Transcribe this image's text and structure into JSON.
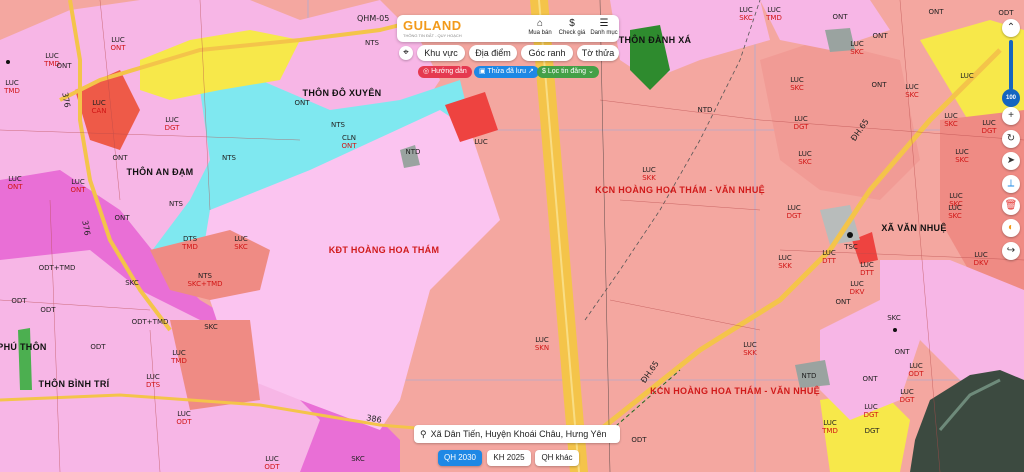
{
  "app": {
    "logo": "GULAND",
    "logo_sub": "THÔNG TIN ĐẤT - QUY HOẠCH"
  },
  "toolbar": {
    "buttons": [
      {
        "label": "Mua bán",
        "icon": "house-icon"
      },
      {
        "label": "Check giá",
        "icon": "dollar-icon"
      },
      {
        "label": "Danh mục",
        "icon": "menu-icon"
      }
    ],
    "chips": [
      "Khu vực",
      "Địa điểm",
      "Góc ranh",
      "Tờ thửa"
    ],
    "pills": [
      {
        "label": "Hướng dẫn",
        "color": "#e53950",
        "icon": "help-icon"
      },
      {
        "label": "Thửa đã lưu",
        "color": "#1e88e5",
        "icon": "bookmark-icon"
      },
      {
        "label": "Lọc tin đăng",
        "color": "#43a047",
        "icon": "dollar-icon"
      }
    ]
  },
  "map": {
    "zoom_level": "100",
    "address": "Xã Dân Tiến, Huyện Khoái Châu, Hưng Yên",
    "place_names": [
      {
        "text": "THÔN ĐÔ XUYÊN"
      },
      {
        "text": "THÔN AN ĐẠM"
      },
      {
        "text": "THÔN ĐÀNH XÁ"
      },
      {
        "text": "XÃ VĂN NHUỆ"
      },
      {
        "text": "THÔN BÌNH TRÍ"
      },
      {
        "text": "PHÚ THÔN"
      }
    ],
    "zones": [
      {
        "text": "KĐT HOÀNG HOA THÁM"
      },
      {
        "text": "KCN HOÀNG HOA THÁM - VĂN NHUỆ"
      },
      {
        "text": "KCN HOÀNG HOA THÁM - VĂN NHUỆ"
      }
    ],
    "roads": [
      "QHM-05",
      "376",
      "376",
      "ĐH.65",
      "ĐH.65",
      "386"
    ],
    "parcels": [
      [
        "LUC",
        "CAN"
      ],
      [
        "LUC",
        "TMD"
      ],
      [
        "LUC",
        "TMD"
      ],
      [
        "ONT",
        ""
      ],
      [
        "ONT",
        ""
      ],
      [
        "ONT",
        ""
      ],
      [
        "ONT",
        ""
      ],
      [
        "NTS",
        ""
      ],
      [
        "NTS",
        ""
      ],
      [
        "NTS",
        ""
      ],
      [
        "NTS",
        ""
      ],
      [
        "CLN",
        "ONT"
      ],
      [
        "NTD",
        ""
      ],
      [
        "LUC",
        "DGT"
      ],
      [
        "LUC",
        ""
      ],
      [
        "LUC",
        "ONT"
      ],
      [
        "LUC",
        "ONT"
      ],
      [
        "LUC",
        "ONT"
      ],
      [
        "DTS",
        "TMD"
      ],
      [
        "LUC",
        "SKC"
      ],
      [
        "NTS",
        "SKC+TMD"
      ],
      [
        "SKC",
        ""
      ],
      [
        "SKC",
        ""
      ],
      [
        "ODT+TMD",
        ""
      ],
      [
        "ODT+TMD",
        ""
      ],
      [
        "ODT",
        ""
      ],
      [
        "ODT",
        ""
      ],
      [
        "ODT",
        ""
      ],
      [
        "LUC",
        "DTS"
      ],
      [
        "LUC",
        "TMD"
      ],
      [
        "LUC",
        "ODT"
      ],
      [
        "LUC",
        "ODT"
      ],
      [
        "SKC",
        ""
      ],
      [
        "LUC",
        "SKN"
      ],
      [
        "LUC",
        "SKK"
      ],
      [
        "NTD",
        ""
      ],
      [
        "LUC",
        "SKC"
      ],
      [
        "LUC",
        "DGT"
      ],
      [
        "LUC",
        "SKC"
      ],
      [
        "LUC",
        "SKC"
      ],
      [
        "LUC",
        "DGT"
      ],
      [
        "LUC",
        ""
      ],
      [
        "LUC",
        "SKC"
      ],
      [
        "LUC",
        "SKC"
      ],
      [
        "LUC",
        "SKC"
      ],
      [
        "LUC",
        "DKV"
      ],
      [
        "LUC",
        "DKV"
      ],
      [
        "LUC",
        "SKK"
      ],
      [
        "LUC",
        "SKK"
      ],
      [
        "NTD",
        ""
      ],
      [
        "ONT",
        ""
      ],
      [
        "ONT",
        ""
      ],
      [
        "ONT",
        ""
      ],
      [
        "LUC",
        "TMD"
      ],
      [
        "LUC",
        "DGT"
      ],
      [
        "LUC",
        "DTT"
      ],
      [
        "ONT",
        ""
      ],
      [
        "ONT",
        ""
      ],
      [
        "ONT",
        ""
      ],
      [
        "ONT",
        ""
      ],
      [
        "LUC",
        "SKC"
      ],
      [
        "LUC",
        "SKC"
      ],
      [
        "LUC",
        "DGT"
      ],
      [
        "LUC",
        "SKC"
      ],
      [
        "ODT",
        ""
      ],
      [
        "LUC",
        "ODT"
      ],
      [
        "LUC",
        "DTT"
      ],
      [
        "SKC",
        ""
      ],
      [
        "DGT",
        ""
      ],
      [
        "TSC",
        ""
      ],
      [
        "LUC",
        "DGT"
      ],
      [
        "LUC",
        "TMD"
      ],
      [
        "ODT",
        ""
      ]
    ]
  },
  "bottom": {
    "buttons": [
      "QH 2030",
      "KH 2025",
      "QH khác"
    ],
    "active": "QH 2030"
  },
  "colors": {
    "luc": "#f4a7a0",
    "ont": "#f7b6e6",
    "nts": "#7fe8f0",
    "skc": "#ef8b84",
    "road": "#f4c44a",
    "odt": "#e96fd6",
    "accent": "#1565c0"
  }
}
